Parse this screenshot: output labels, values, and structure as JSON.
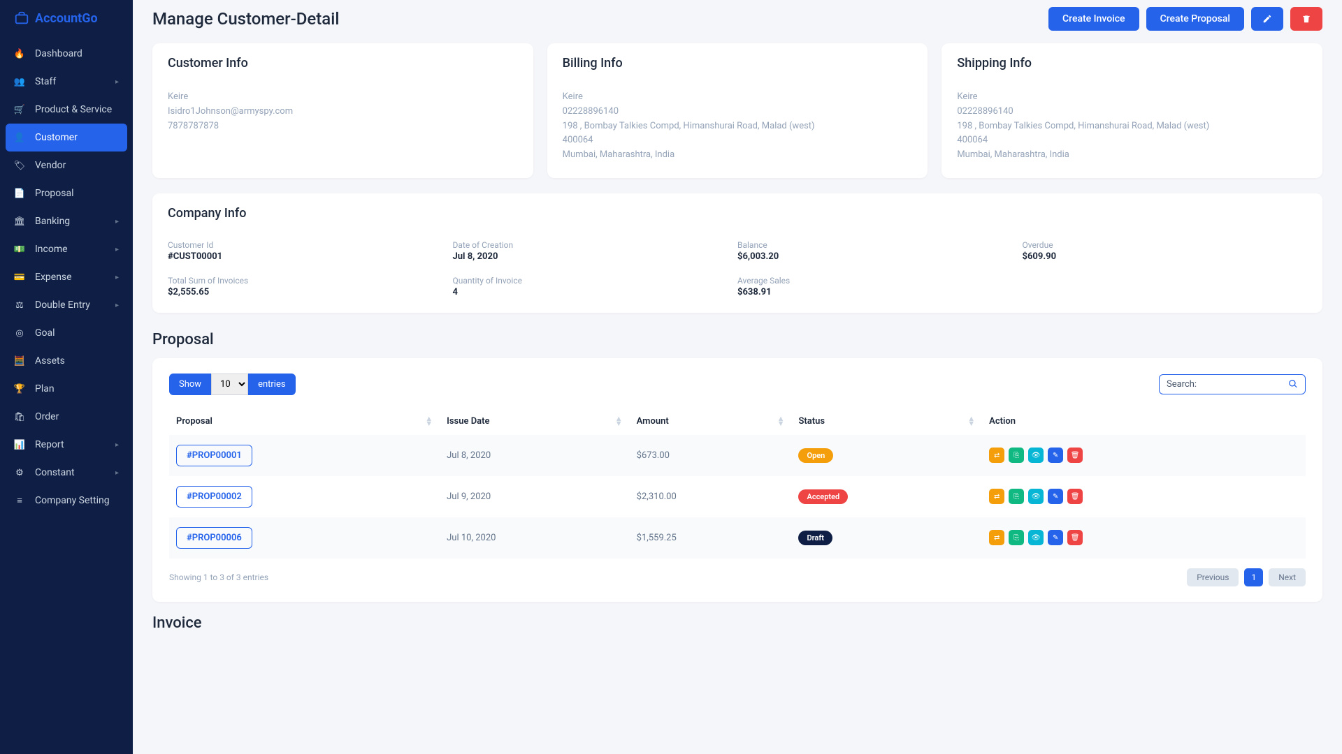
{
  "app_name": "AccountGo",
  "page_title": "Manage Customer-Detail",
  "header_buttons": {
    "create_invoice": "Create Invoice",
    "create_proposal": "Create Proposal"
  },
  "sidebar": {
    "items": [
      {
        "label": "Dashboard",
        "icon": "🔥",
        "sub": false
      },
      {
        "label": "Staff",
        "icon": "👥",
        "sub": true
      },
      {
        "label": "Product & Service",
        "icon": "🛒",
        "sub": false
      },
      {
        "label": "Customer",
        "icon": "👤",
        "sub": false,
        "active": true
      },
      {
        "label": "Vendor",
        "icon": "🏷",
        "sub": false
      },
      {
        "label": "Proposal",
        "icon": "📄",
        "sub": false
      },
      {
        "label": "Banking",
        "icon": "🏛",
        "sub": true
      },
      {
        "label": "Income",
        "icon": "💵",
        "sub": true
      },
      {
        "label": "Expense",
        "icon": "💳",
        "sub": true
      },
      {
        "label": "Double Entry",
        "icon": "⚖",
        "sub": true
      },
      {
        "label": "Goal",
        "icon": "◎",
        "sub": false
      },
      {
        "label": "Assets",
        "icon": "🧮",
        "sub": false
      },
      {
        "label": "Plan",
        "icon": "🏆",
        "sub": false
      },
      {
        "label": "Order",
        "icon": "🛍",
        "sub": false
      },
      {
        "label": "Report",
        "icon": "📊",
        "sub": true
      },
      {
        "label": "Constant",
        "icon": "⚙",
        "sub": true
      },
      {
        "label": "Company Setting",
        "icon": "≡",
        "sub": false
      }
    ]
  },
  "customer_info": {
    "title": "Customer Info",
    "name": "Keire",
    "email": "Isidro1Johnson@armyspy.com",
    "phone": "7878787878"
  },
  "billing_info": {
    "title": "Billing Info",
    "name": "Keire",
    "phone": "02228896140",
    "address": "198 , Bombay Talkies Compd, Himanshurai Road, Malad (west)",
    "zip": "400064",
    "city": "Mumbai, Maharashtra, India"
  },
  "shipping_info": {
    "title": "Shipping Info",
    "name": "Keire",
    "phone": "02228896140",
    "address": "198 , Bombay Talkies Compd, Himanshurai Road, Malad (west)",
    "zip": "400064",
    "city": "Mumbai, Maharashtra, India"
  },
  "company_info": {
    "title": "Company Info",
    "stats": [
      {
        "label": "Customer Id",
        "value": "#CUST00001"
      },
      {
        "label": "Date of Creation",
        "value": "Jul 8, 2020"
      },
      {
        "label": "Balance",
        "value": "$6,003.20"
      },
      {
        "label": "Overdue",
        "value": "$609.90"
      },
      {
        "label": "Total Sum of Invoices",
        "value": "$2,555.65"
      },
      {
        "label": "Quantity of Invoice",
        "value": "4"
      },
      {
        "label": "Average Sales",
        "value": "$638.91"
      }
    ]
  },
  "proposal_section": {
    "title": "Proposal",
    "show_label": "Show",
    "entries_label": "entries",
    "entries_value": "10",
    "search_label": "Search:",
    "columns": [
      "Proposal",
      "Issue Date",
      "Amount",
      "Status",
      "Action"
    ],
    "rows": [
      {
        "id": "#PROP00001",
        "date": "Jul 8, 2020",
        "amount": "$673.00",
        "status": "Open",
        "status_class": "status-open"
      },
      {
        "id": "#PROP00002",
        "date": "Jul 9, 2020",
        "amount": "$2,310.00",
        "status": "Accepted",
        "status_class": "status-accepted"
      },
      {
        "id": "#PROP00006",
        "date": "Jul 10, 2020",
        "amount": "$1,559.25",
        "status": "Draft",
        "status_class": "status-draft"
      }
    ],
    "footer_info": "Showing 1 to 3 of 3 entries",
    "prev": "Previous",
    "next": "Next",
    "page": "1"
  },
  "invoice_section": {
    "title": "Invoice"
  }
}
